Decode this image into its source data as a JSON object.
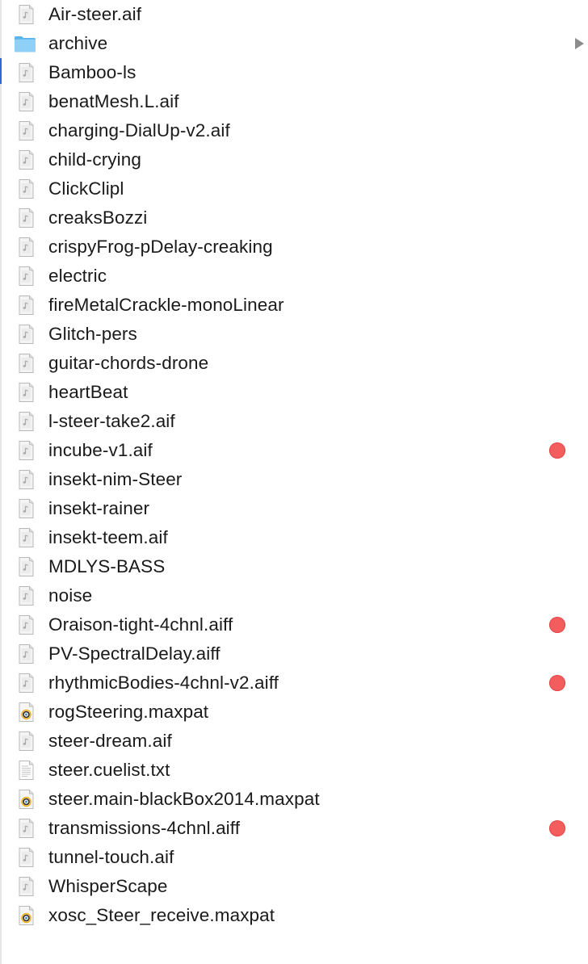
{
  "tag_color": "#f45d5d",
  "items": [
    {
      "name": "Air-steer.aif",
      "kind": "audio-file-icon",
      "tag": false
    },
    {
      "name": "archive",
      "kind": "folder-icon",
      "tag": false,
      "folder": true
    },
    {
      "name": "Bamboo-ls",
      "kind": "audio-file-icon",
      "tag": false
    },
    {
      "name": "benatMesh.L.aif",
      "kind": "audio-file-icon",
      "tag": false
    },
    {
      "name": "charging-DialUp-v2.aif",
      "kind": "audio-file-icon",
      "tag": false
    },
    {
      "name": "child-crying",
      "kind": "audio-file-icon",
      "tag": false
    },
    {
      "name": "ClickClipl",
      "kind": "audio-file-icon",
      "tag": false
    },
    {
      "name": "creaksBozzi",
      "kind": "audio-file-icon",
      "tag": false
    },
    {
      "name": "crispyFrog-pDelay-creaking",
      "kind": "audio-file-icon",
      "tag": false
    },
    {
      "name": "electric",
      "kind": "audio-file-icon",
      "tag": false
    },
    {
      "name": "fireMetalCrackle-monoLinear",
      "kind": "audio-file-icon",
      "tag": false
    },
    {
      "name": "Glitch-pers",
      "kind": "audio-file-icon",
      "tag": false
    },
    {
      "name": "guitar-chords-drone",
      "kind": "audio-file-icon",
      "tag": false
    },
    {
      "name": "heartBeat",
      "kind": "audio-file-icon",
      "tag": false
    },
    {
      "name": "l-steer-take2.aif",
      "kind": "audio-file-icon",
      "tag": false
    },
    {
      "name": "incube-v1.aif",
      "kind": "audio-file-icon",
      "tag": true
    },
    {
      "name": "insekt-nim-Steer",
      "kind": "audio-file-icon",
      "tag": false
    },
    {
      "name": "insekt-rainer",
      "kind": "audio-file-icon",
      "tag": false
    },
    {
      "name": "insekt-teem.aif",
      "kind": "audio-file-icon",
      "tag": false
    },
    {
      "name": "MDLYS-BASS",
      "kind": "audio-file-icon",
      "tag": false
    },
    {
      "name": "noise",
      "kind": "audio-file-icon",
      "tag": false
    },
    {
      "name": "Oraison-tight-4chnl.aiff",
      "kind": "audio-file-icon",
      "tag": true
    },
    {
      "name": "PV-SpectralDelay.aiff",
      "kind": "audio-file-icon",
      "tag": false
    },
    {
      "name": "rhythmicBodies-4chnl-v2.aiff",
      "kind": "audio-file-icon",
      "tag": true
    },
    {
      "name": "rogSteering.maxpat",
      "kind": "maxpat-file-icon",
      "tag": false
    },
    {
      "name": "steer-dream.aif",
      "kind": "audio-file-icon",
      "tag": false
    },
    {
      "name": "steer.cuelist.txt",
      "kind": "text-file-icon",
      "tag": false
    },
    {
      "name": "steer.main-blackBox2014.maxpat",
      "kind": "maxpat-file-icon",
      "tag": false
    },
    {
      "name": "transmissions-4chnl.aiff",
      "kind": "audio-file-icon",
      "tag": true
    },
    {
      "name": "tunnel-touch.aif",
      "kind": "audio-file-icon",
      "tag": false
    },
    {
      "name": "WhisperScape",
      "kind": "audio-file-icon",
      "tag": false
    },
    {
      "name": "xosc_Steer_receive.maxpat",
      "kind": "maxpat-file-icon",
      "tag": false
    }
  ]
}
